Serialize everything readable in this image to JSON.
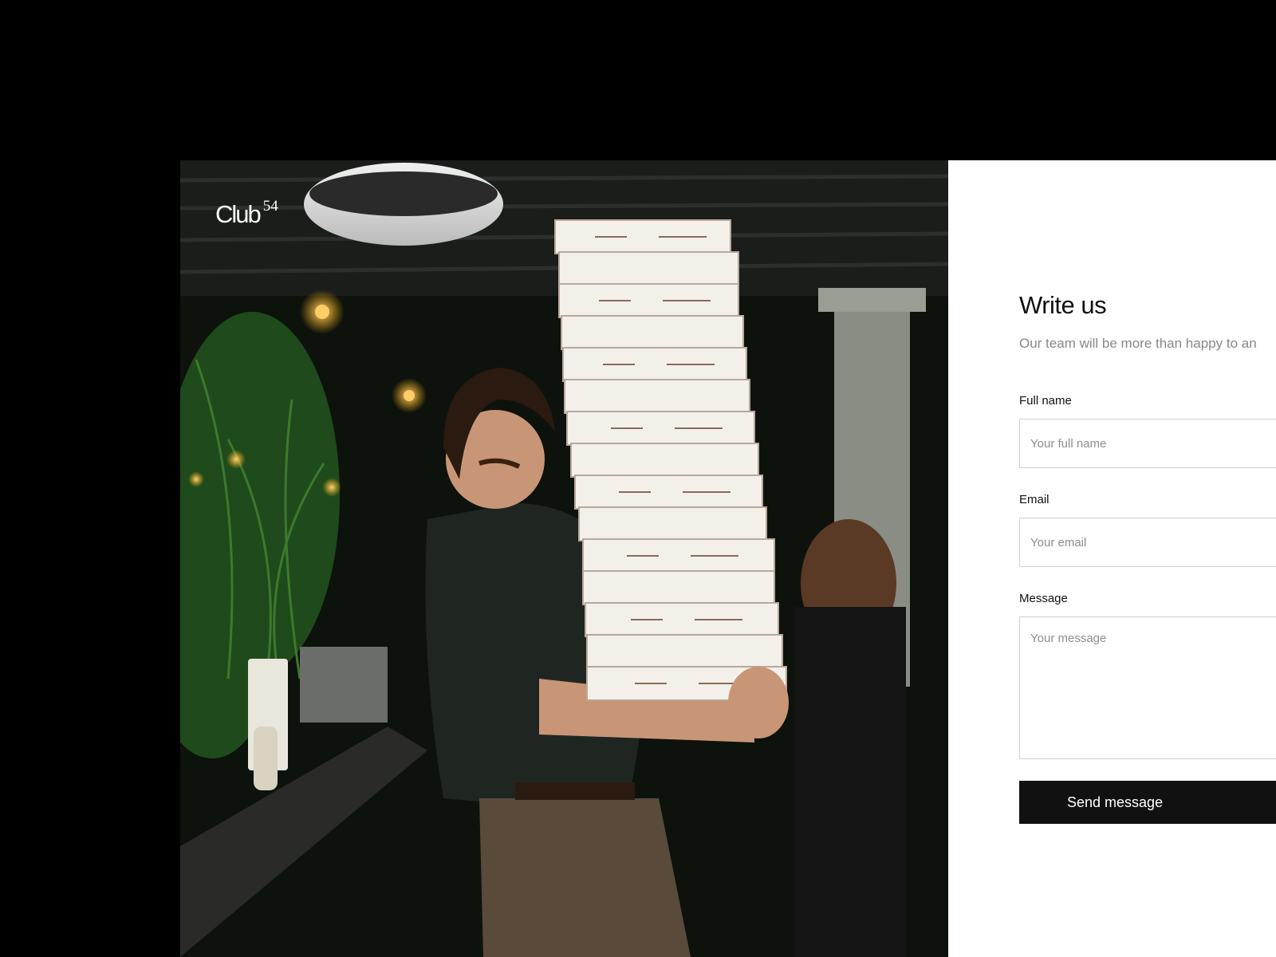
{
  "brand": {
    "name": "Club",
    "superscript": "54"
  },
  "form": {
    "title": "Write us",
    "subtitle": "Our team will be more than happy to an",
    "full_name": {
      "label": "Full name",
      "placeholder": "Your full name"
    },
    "email": {
      "label": "Email",
      "placeholder": "Your email"
    },
    "message": {
      "label": "Message",
      "placeholder": "Your message"
    },
    "submit_label": "Send message"
  },
  "colors": {
    "page_background": "#000000",
    "form_background": "#ffffff",
    "button": "#111111",
    "muted_text": "#888888"
  }
}
